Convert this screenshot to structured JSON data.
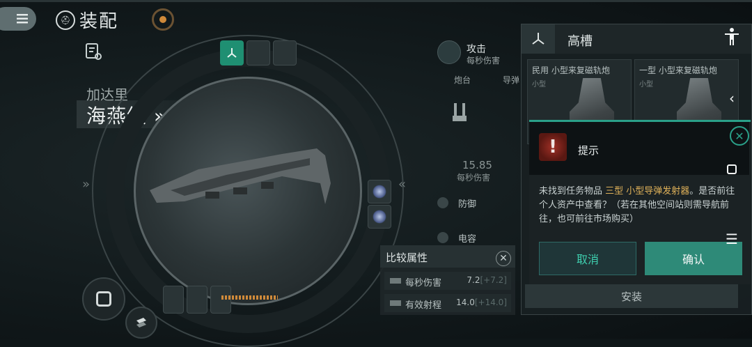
{
  "header": {
    "title": "装配",
    "title_icon_text": "⛑"
  },
  "ship": {
    "faction": "加达里",
    "class_name": "海燕级 »"
  },
  "stats": {
    "attack_label": "攻击",
    "attack_sub": "每秒伤害",
    "col_turret": "炮台",
    "col_missile": "导弹",
    "dps_value": "15.85",
    "dps_label": "每秒伤害",
    "defense_label": "防御",
    "capacitor_label": "电容"
  },
  "compare": {
    "title": "比较属性",
    "close_icon": "✕",
    "rows": [
      {
        "label": "每秒伤害",
        "value": "7.2",
        "delta": "[+7.2]"
      },
      {
        "label": "有效射程",
        "value": "14.0",
        "delta": "[+14.0]"
      }
    ]
  },
  "high_slot": {
    "title": "高槽",
    "modules": [
      {
        "name": "民用 小型来复磁轨炮",
        "size": "小型"
      },
      {
        "name": "一型 小型来复磁轨炮",
        "size": "小型"
      }
    ],
    "install_label": "安装"
  },
  "dialog": {
    "title": "提示",
    "warn_glyph": "!",
    "close_icon": "✕",
    "msg_before": "未找到任务物品 ",
    "msg_item": "三型 小型导弹发射器",
    "msg_after": "。是否前往个人资产中查看？（若在其他空间站则需导航前往，也可前往市场购买）",
    "cancel_label": "取消",
    "confirm_label": "确认"
  },
  "ring": {
    "left_arrow": "»",
    "right_arrow": "«",
    "capacitor_progress_fraction": 0.55
  },
  "system_nav": {
    "back": "‹",
    "menu": "☰"
  },
  "colors": {
    "accent_teal": "#2aa089",
    "highlight_gold": "#e0b25a",
    "warning_red": "#a03026"
  }
}
